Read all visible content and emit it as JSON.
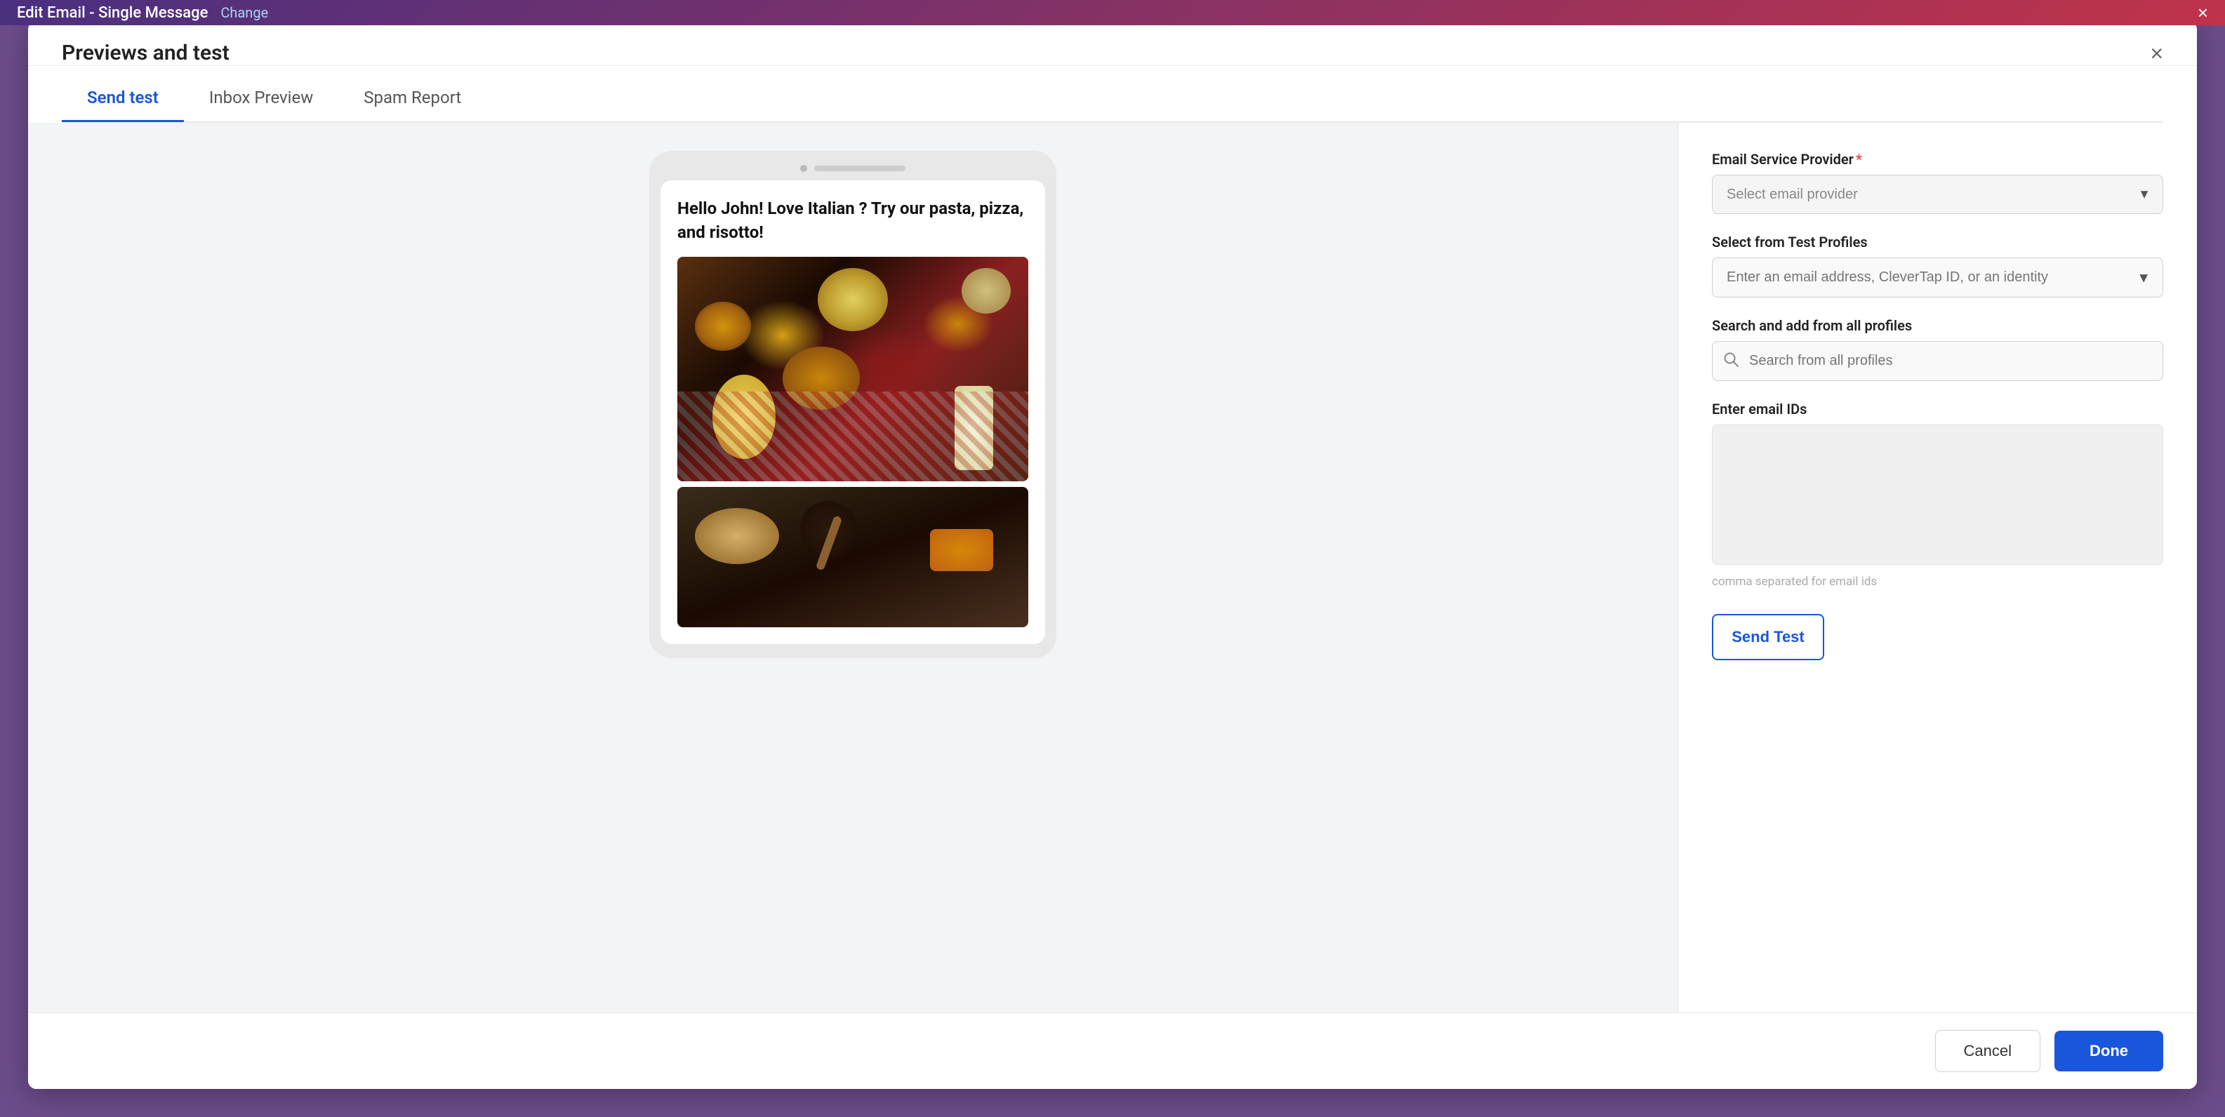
{
  "topBar": {
    "title": "Edit Email - Single Message",
    "changeLabel": "Change",
    "closeLabel": "×"
  },
  "modal": {
    "title": "Previews and test",
    "closeLabel": "×",
    "tabs": [
      {
        "id": "send-test",
        "label": "Send test",
        "active": true
      },
      {
        "id": "inbox-preview",
        "label": "Inbox Preview",
        "active": false
      },
      {
        "id": "spam-report",
        "label": "Spam Report",
        "active": false
      }
    ],
    "emailPreview": {
      "greeting": "Hello John! Love Italian ? Try our pasta, pizza, and risotto!"
    },
    "rightPanel": {
      "emailServiceProvider": {
        "label": "Email Service Provider",
        "required": true,
        "placeholder": "Select email provider"
      },
      "testProfiles": {
        "label": "Select from Test Profiles",
        "placeholder": "Enter an email address, CleverTap ID, or an identity"
      },
      "searchProfiles": {
        "label": "Search and add from all profiles",
        "placeholder": "Search from all profiles"
      },
      "emailIds": {
        "label": "Enter email IDs",
        "placeholder": "",
        "hint": "comma separated for email ids"
      },
      "sendTestButton": "Send Test"
    },
    "footer": {
      "cancelLabel": "Cancel",
      "doneLabel": "Done"
    }
  }
}
